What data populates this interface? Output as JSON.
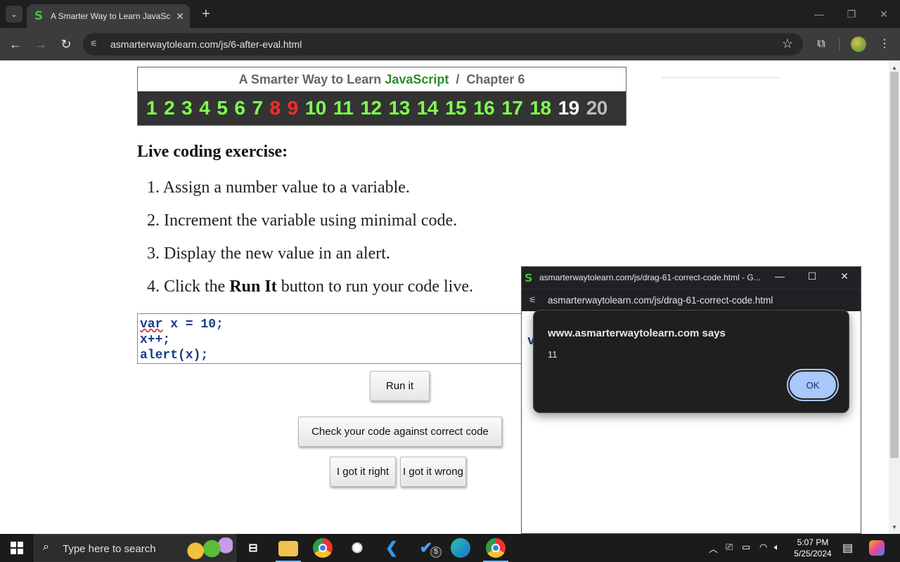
{
  "browser": {
    "tab_title": "A Smarter Way to Learn JavaScript",
    "tab_favicon": "S",
    "url": "asmarterwaytolearn.com/js/6-after-eval.html"
  },
  "page": {
    "chapter_title_prefix": "A Smarter Way to Learn ",
    "chapter_title_js": "JavaScript",
    "chapter_title_suffix": "  /  Chapter 6",
    "chapters": [
      "1",
      "2",
      "3",
      "4",
      "5",
      "6",
      "7",
      "8",
      "9",
      "10",
      "11",
      "12",
      "13",
      "14",
      "15",
      "16",
      "17",
      "18",
      "19",
      "20"
    ],
    "heading": "Live coding exercise:",
    "steps": [
      {
        "num": "1.",
        "text": "Assign a number value to a variable."
      },
      {
        "num": "2.",
        "text": "Increment the variable using minimal code."
      },
      {
        "num": "3.",
        "text": "Display the new value in an alert."
      },
      {
        "num": "4.",
        "text_before": "Click the ",
        "bold": "Run It",
        "text_after": " button to run your code live."
      }
    ],
    "code_lines": {
      "line1_keyword": "var",
      "line1_rest": " x = 10;",
      "line2": "x++;",
      "line3": "alert(x);"
    },
    "run_button": "Run it",
    "check_button": "Check your code against correct code",
    "right_button": "I got it right",
    "wrong_button": "I got it wrong"
  },
  "popup": {
    "favicon": "S",
    "title": "asmarterwaytolearn.com/js/drag-61-correct-code.html - G...",
    "url": "asmarterwaytolearn.com/js/drag-61-correct-code.html",
    "partial_code": "v"
  },
  "alert": {
    "title": "www.asmarterwaytolearn.com says",
    "message": "11",
    "ok": "OK"
  },
  "taskbar": {
    "search_placeholder": "Type here to search",
    "time": "5:07 PM",
    "date": "5/25/2024",
    "todo_badge": "5"
  }
}
